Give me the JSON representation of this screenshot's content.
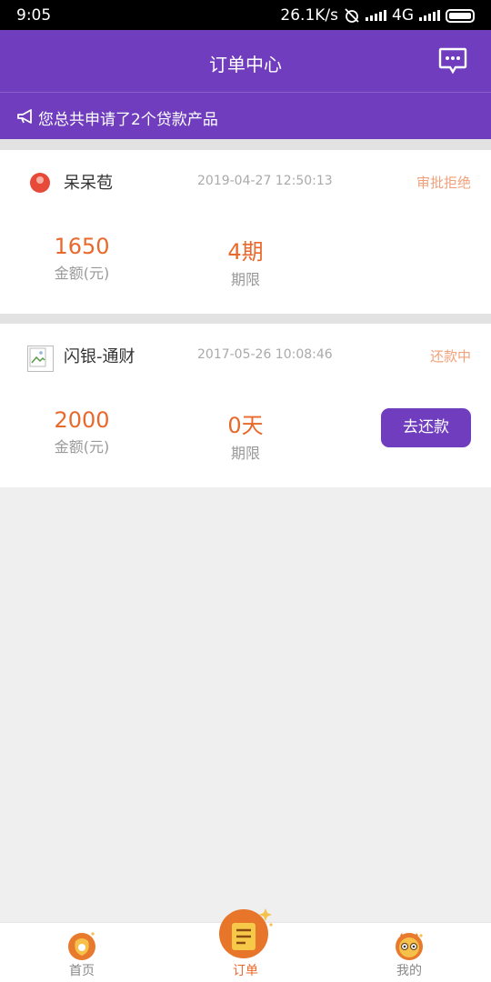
{
  "status_bar": {
    "time": "9:05",
    "speed": "26.1K/s",
    "network": "4G"
  },
  "header": {
    "title": "订单中心"
  },
  "notice": {
    "text": "您总共申请了2个贷款产品"
  },
  "orders": [
    {
      "name": "呆呆苞",
      "date": "2019-04-27 12:50:13",
      "status": "审批拒绝",
      "amount": "1650",
      "amount_label": "金额(元)",
      "term": "4期",
      "term_label": "期限"
    },
    {
      "name": "闪银-通财",
      "date": "2017-05-26 10:08:46",
      "status": "还款中",
      "amount": "2000",
      "amount_label": "金额(元)",
      "term": "0天",
      "term_label": "期限",
      "action": "去还款"
    }
  ],
  "tabbar": {
    "home": "首页",
    "order": "订单",
    "mine": "我的"
  },
  "colors": {
    "brand": "#6f3dbd",
    "accent": "#e8692b",
    "status": "#f0a07a"
  }
}
